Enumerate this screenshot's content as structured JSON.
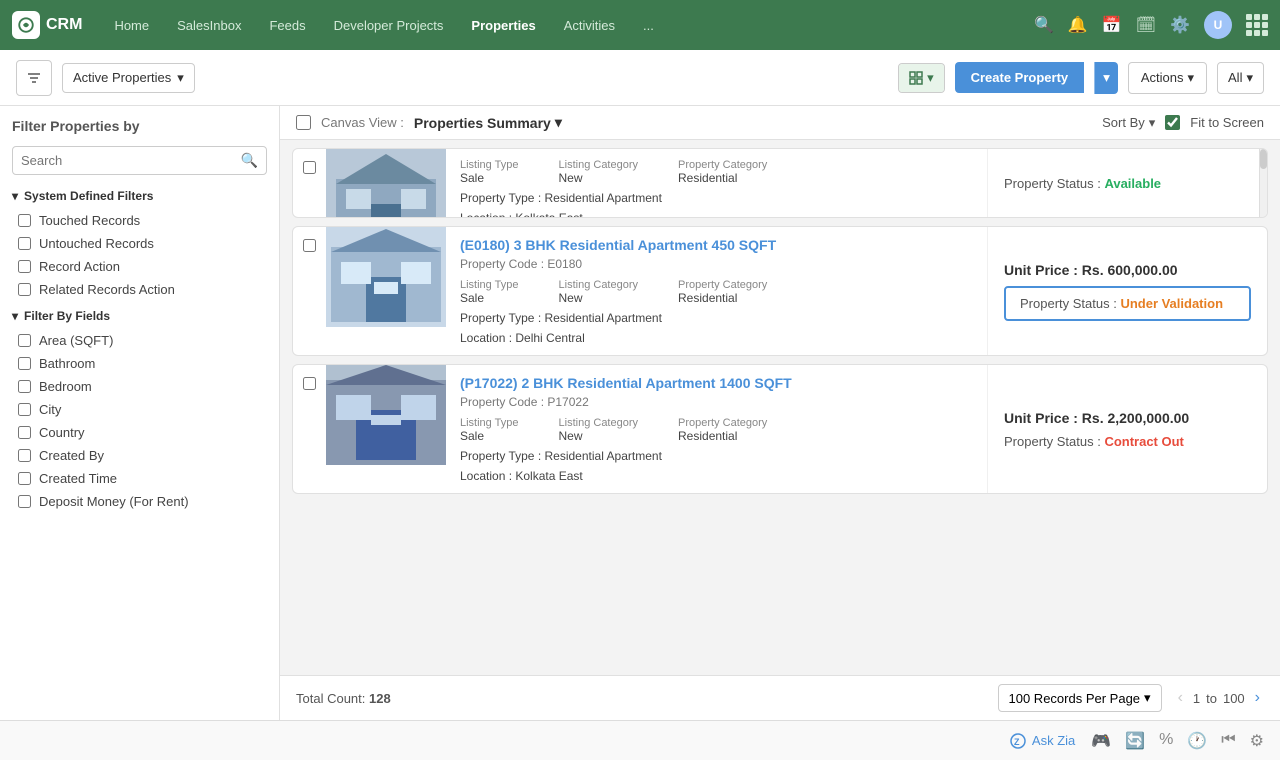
{
  "app": {
    "logo_text": "CRM",
    "nav_items": [
      "Home",
      "SalesInbox",
      "Feeds",
      "Developer Projects",
      "Properties",
      "Activities",
      "..."
    ]
  },
  "toolbar": {
    "active_filter": "Active Properties",
    "create_label": "Create Property",
    "actions_label": "Actions",
    "all_label": "All"
  },
  "canvas": {
    "view_label": "Canvas View :",
    "view_name": "Properties Summary",
    "sort_by": "Sort By",
    "fit_to_screen": "Fit to Screen"
  },
  "sidebar": {
    "filter_title": "Filter Properties by",
    "search_placeholder": "Search",
    "system_filters": {
      "title": "System Defined Filters",
      "items": [
        "Touched Records",
        "Untouched Records",
        "Record Action",
        "Related Records Action"
      ]
    },
    "field_filters": {
      "title": "Filter By Fields",
      "items": [
        "Area (SQFT)",
        "Bathroom",
        "Bedroom",
        "City",
        "Country",
        "Created By",
        "Created Time",
        "Deposit Money (For Rent)"
      ]
    }
  },
  "properties": [
    {
      "id": "top-partial",
      "title": "",
      "code": "",
      "listing_type": "Sale",
      "listing_category": "New",
      "property_category": "Residential",
      "property_type": "Residential Apartment",
      "location": "Kolkata East",
      "unit_price": "",
      "status": "Available",
      "status_class": "available",
      "partial": true
    },
    {
      "id": "E0180",
      "title": "(E0180) 3 BHK Residential Apartment 450 SQFT",
      "code": "E0180",
      "listing_type": "Sale",
      "listing_category": "New",
      "property_category": "Residential",
      "property_type": "Residential Apartment",
      "location": "Delhi Central",
      "unit_price": "Rs. 600,000.00",
      "status": "Under Validation",
      "status_class": "validation",
      "highlighted": true
    },
    {
      "id": "P17022",
      "title": "(P17022) 2 BHK Residential Apartment 1400 SQFT",
      "code": "P17022",
      "listing_type": "Sale",
      "listing_category": "New",
      "property_category": "Residential",
      "property_type": "Residential Apartment",
      "location": "Kolkata East",
      "unit_price": "Rs. 2,200,000.00",
      "status": "Contract Out",
      "status_class": "contract",
      "partial_bottom": true
    }
  ],
  "footer": {
    "total_count_label": "Total Count:",
    "total_count": "128",
    "per_page": "100 Records Per Page",
    "page_current": "1",
    "page_separator": "to",
    "page_total": "100"
  },
  "bottom_bar": {
    "ask_zia": "Ask Zia"
  },
  "labels": {
    "listing_type": "Listing Type",
    "listing_category": "Listing Category",
    "property_category": "Property Category",
    "property_type": "Property Type :",
    "location": "Location :",
    "property_status": "Property Status :",
    "unit_price": "Unit Price :"
  }
}
